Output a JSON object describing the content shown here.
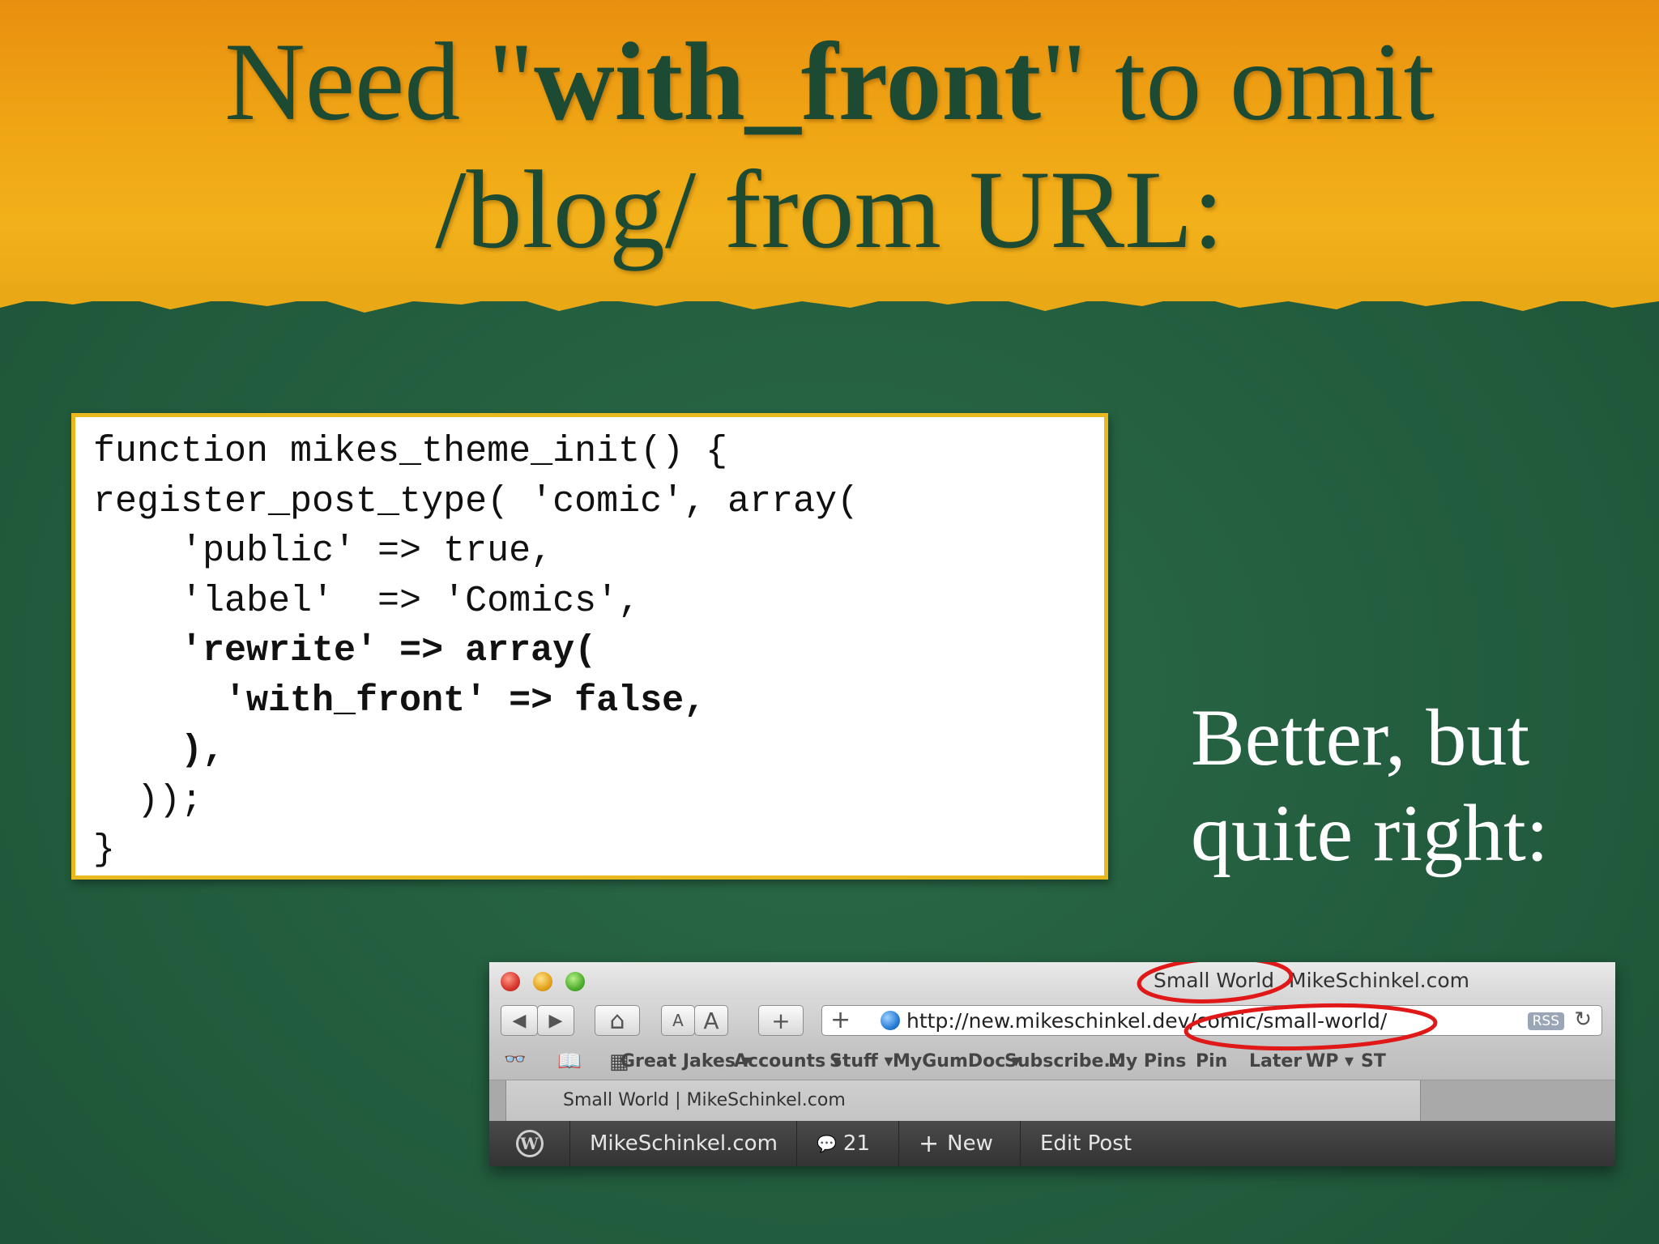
{
  "slide": {
    "title_pre": "Need \"",
    "title_bold": "with_front",
    "title_post": "\" to omit",
    "title_line2": "/blog/  from URL:",
    "side_line1": "Better, but",
    "side_line2": "quite right:"
  },
  "code_lines": [
    {
      "text": "function mikes_theme_init() {",
      "bold": false
    },
    {
      "text": "register_post_type( 'comic', array(",
      "bold": false
    },
    {
      "text": "    'public' => true,",
      "bold": false
    },
    {
      "text": "    'label'  => 'Comics',",
      "bold": false
    },
    {
      "text": "    'rewrite' => array(",
      "bold": true
    },
    {
      "text": "      'with_front' => false,",
      "bold": true
    },
    {
      "text": "    ),",
      "bold": true
    },
    {
      "text": "  ));",
      "bold": false
    },
    {
      "text": "}",
      "bold": false
    }
  ],
  "browser": {
    "window_title_page": "Small World",
    "window_title_site": "MikeSchinkel.com",
    "url": "http://new.mikeschinkel.dev/comic/small-world/",
    "rss_label": "RSS",
    "toolbar": {
      "back": "◀",
      "forward": "▶",
      "home": "⌂",
      "text_smaller": "A",
      "text_larger": "A",
      "add_bookmark": "+",
      "new_tab": "+",
      "reload": "↻"
    },
    "bookmarks_icons": {
      "reading_list": "👓",
      "bookmarks": "📖",
      "top_sites": "▦"
    },
    "bookmarks": [
      "Great Jakes ▾",
      "Accounts ▾",
      "Stuff ▾",
      "MyGumDoc ▾",
      "Subscribe...",
      "My Pins",
      "Pin",
      "Later",
      "WP ▾",
      "ST"
    ],
    "tab_label": "Small World | MikeSchinkel.com",
    "admin_bar": {
      "logo": "W",
      "site": "MikeSchinkel.com",
      "comments_icon": "💬",
      "comments_count": "21",
      "new_icon": "+",
      "new_label": "New",
      "edit_label": "Edit Post"
    }
  },
  "colors": {
    "title_text": "#1d4a32",
    "band_orange": "#efa414",
    "background_green": "#245f40",
    "code_border": "#e8b81e",
    "annotation_red": "#e01818"
  }
}
